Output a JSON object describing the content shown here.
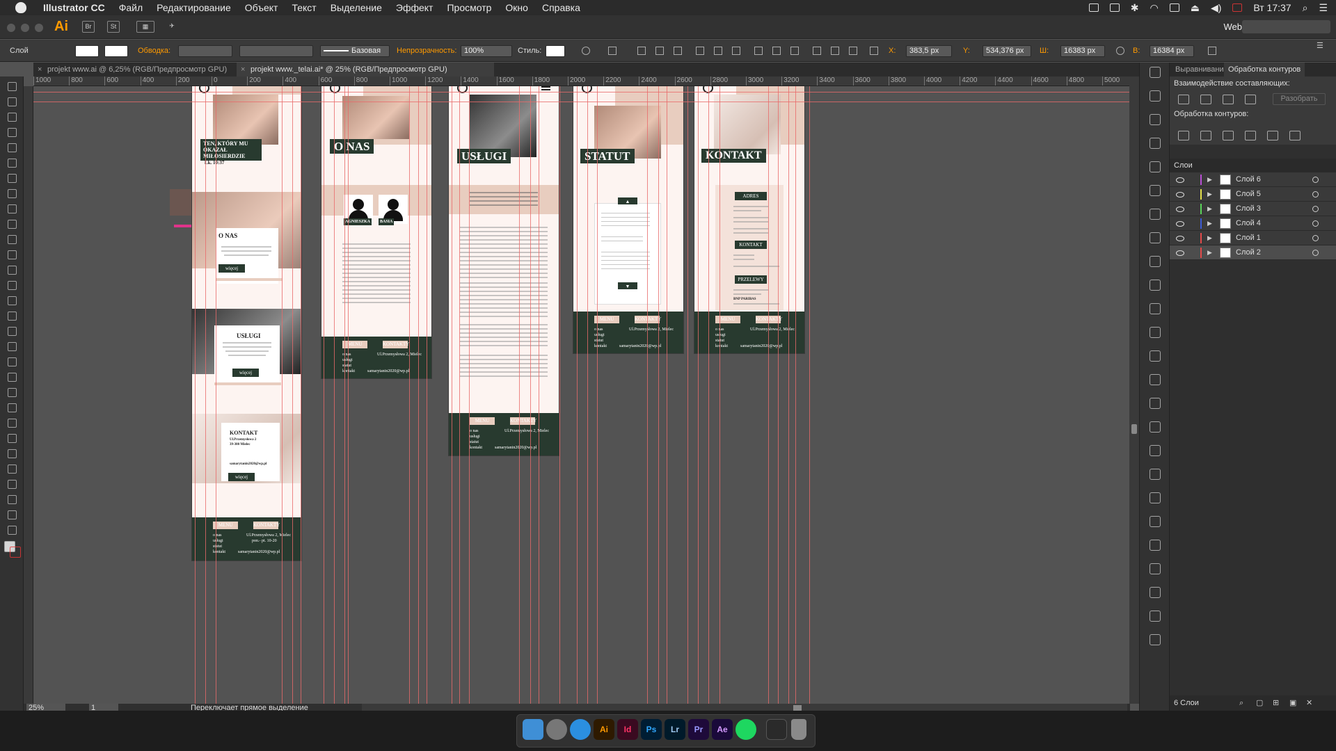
{
  "menubar": {
    "app": "Illustrator CC",
    "items": [
      "Файл",
      "Редактирование",
      "Объект",
      "Текст",
      "Выделение",
      "Эффект",
      "Просмотр",
      "Окно",
      "Справка"
    ],
    "clock": "Вт 17:37"
  },
  "appbar": {
    "logo": "Ai",
    "workspace": "Web"
  },
  "control": {
    "selection": "Слой",
    "stroke_label": "Обводка:",
    "stroke_style": "Базовая",
    "opacity_label": "Непрозрачность:",
    "opacity": "100%",
    "style_label": "Стиль:",
    "x_label": "X:",
    "x": "383,5 px",
    "y_label": "Y:",
    "y": "534,376 px",
    "w_label": "Ш:",
    "w": "16383 px",
    "h_label": "В:",
    "h": "16384 px"
  },
  "tabs": [
    {
      "label": "projekt www.ai @ 6,25% (RGB/Предпросмотр GPU)"
    },
    {
      "label": "projekt www._telai.ai* @ 25% (RGB/Предпросмотр GPU)"
    }
  ],
  "ruler_ticks": [
    "1000",
    "800",
    "600",
    "400",
    "200",
    "0",
    "200",
    "400",
    "600",
    "800",
    "1000",
    "1200",
    "1400",
    "1600",
    "1800",
    "2000",
    "2200",
    "2400",
    "2600",
    "2800",
    "3000",
    "3200",
    "3400",
    "3600",
    "3800",
    "4000",
    "4200",
    "4400",
    "4600",
    "4800",
    "5000"
  ],
  "status": {
    "zoom": "25%",
    "artboard": "1",
    "hint": "Переключает прямое выделение"
  },
  "panels": {
    "tab1": "Выравнивани",
    "tab2": "Обработка контуров",
    "combine_title": "Взаимодействие составляющих:",
    "split_btn": "Разобрать",
    "pathfinder_title": "Обработка контуров:",
    "layers_title": "Слои",
    "layers_count": "6 Слои"
  },
  "layers": [
    {
      "name": "Слой 6",
      "color": "#b84fd4"
    },
    {
      "name": "Слой 5",
      "color": "#e3e04a"
    },
    {
      "name": "Слой 3",
      "color": "#5ad45a"
    },
    {
      "name": "Слой 4",
      "color": "#3d5bd6"
    },
    {
      "name": "Слой 1",
      "color": "#e34a4a"
    },
    {
      "name": "Слой 2",
      "color": "#e34a4a"
    }
  ],
  "artboards": {
    "home": {
      "quote": "TEN, KTÓRY MU OKAZAŁ MIŁOSIERDZIE",
      "verse": "Łk. 10:37",
      "about_title": "O NAS",
      "about_btn": "więcej",
      "services_title": "USŁUGI",
      "services_btn": "więcej",
      "contact_title": "KONTAKT",
      "contact_btn": "więcej",
      "addr1": "Ul.Przemysłowa 2",
      "addr2": "39-300 Mielec",
      "email": "samarytanin2020@wp.pl"
    },
    "onas": {
      "title": "O NAS",
      "person1": "AGNIESZKA",
      "person2": "BASIA"
    },
    "uslugi": {
      "title": "USŁUGI"
    },
    "statut": {
      "title": "STATUT"
    },
    "kontakt": {
      "title": "KONTAKT",
      "adres": "ADRES",
      "kontakt": "KONTAKT",
      "przelewy": "PRZELEWY",
      "bank": "BNP PARIBAS"
    },
    "footer": {
      "menu": "MENU",
      "kontakt": "KONTAKTY",
      "links": [
        "o nas",
        "usługi",
        "statut",
        "kontakt"
      ],
      "address": "Ul.Przemysłowa 2, Mielec",
      "hours": "pon.- pt. 10-20",
      "email": "samarytanin2020@wp.pl"
    }
  },
  "dock": [
    "Ai",
    "Id",
    "Ps",
    "Lr",
    "Pr",
    "Ae"
  ]
}
